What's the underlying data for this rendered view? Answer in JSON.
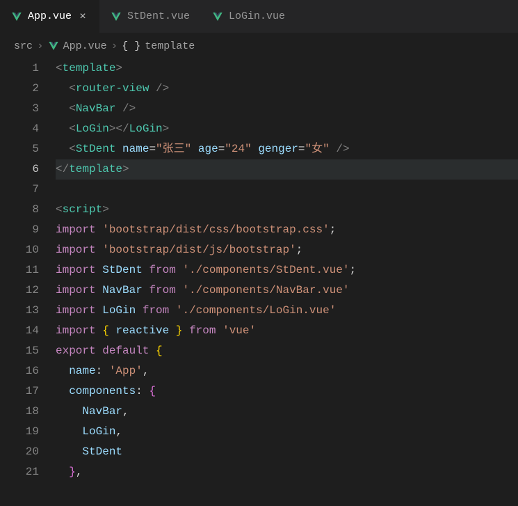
{
  "tabs": [
    {
      "name": "App.vue",
      "active": true
    },
    {
      "name": "StDent.vue",
      "active": false
    },
    {
      "name": "LoGin.vue",
      "active": false
    }
  ],
  "breadcrumb": {
    "src": "src",
    "file": "App.vue",
    "section": "template"
  },
  "code": {
    "l1": {
      "tag": "template"
    },
    "l2": {
      "tag": "router-view"
    },
    "l3": {
      "tag": "NavBar"
    },
    "l4": {
      "tag": "LoGin"
    },
    "l5": {
      "tag": "StDent",
      "a1": "name",
      "v1": "\"张三\"",
      "a2": "age",
      "v2": "\"24\"",
      "a3": "genger",
      "v3": "\"女\""
    },
    "l6": {
      "tag": "template"
    },
    "l8": {
      "tag": "script"
    },
    "l9": {
      "kw": "import",
      "str": "'bootstrap/dist/css/bootstrap.css'"
    },
    "l10": {
      "kw": "import",
      "str": "'bootstrap/dist/js/bootstrap'"
    },
    "l11": {
      "kw": "import",
      "var": "StDent",
      "from": "from",
      "str": "'./components/StDent.vue'"
    },
    "l12": {
      "kw": "import",
      "var": "NavBar",
      "from": "from",
      "str": "'./components/NavBar.vue'"
    },
    "l13": {
      "kw": "import",
      "var": "LoGin",
      "from": "from",
      "str": "'./components/LoGin.vue'"
    },
    "l14": {
      "kw": "import",
      "var": "reactive",
      "from": "from",
      "str": "'vue'"
    },
    "l15": {
      "kw1": "export",
      "kw2": "default"
    },
    "l16": {
      "prop": "name",
      "val": "'App'"
    },
    "l17": {
      "prop": "components"
    },
    "l18": {
      "var": "NavBar"
    },
    "l19": {
      "var": "LoGin"
    },
    "l20": {
      "var": "StDent"
    }
  },
  "linenums": [
    "1",
    "2",
    "3",
    "4",
    "5",
    "6",
    "7",
    "8",
    "9",
    "10",
    "11",
    "12",
    "13",
    "14",
    "15",
    "16",
    "17",
    "18",
    "19",
    "20",
    "21"
  ]
}
